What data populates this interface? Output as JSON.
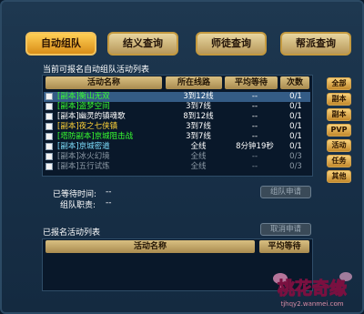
{
  "tabs": [
    {
      "label": "自动组队",
      "active": true
    },
    {
      "label": "结义查询",
      "active": false
    },
    {
      "label": "师徒查询",
      "active": false
    },
    {
      "label": "帮派查询",
      "active": false
    }
  ],
  "available_title": "当前可报名自动组队活动列表",
  "columns": {
    "name": "活动名称",
    "lines": "所在线路",
    "wait": "平均等待",
    "count": "次数"
  },
  "activities": [
    {
      "tag": "[副本]",
      "title": "衡山无双",
      "lines": "3到12线",
      "wait": "--",
      "count": "0/1",
      "color": "g",
      "selected": true
    },
    {
      "tag": "[副本]",
      "title": "盗梦空间",
      "lines": "3到7线",
      "wait": "--",
      "count": "0/1",
      "color": "g",
      "selected": false
    },
    {
      "tag": "[副本]",
      "title": "幽灵的镇魂歌",
      "lines": "8到12线",
      "wait": "--",
      "count": "0/1",
      "color": "w",
      "selected": false
    },
    {
      "tag": "[副本]",
      "title": "夜之七侠镇",
      "lines": "3到7线",
      "wait": "--",
      "count": "0/1",
      "color": "y",
      "selected": false
    },
    {
      "tag": "[塔防副本]",
      "title": "京城阻击战",
      "lines": "3到7线",
      "wait": "--",
      "count": "0/1",
      "color": "g",
      "selected": false
    },
    {
      "tag": "[副本]",
      "title": "京城密道",
      "lines": "全线",
      "wait": "8分钟19秒",
      "count": "0/1",
      "color": "c",
      "selected": false
    },
    {
      "tag": "[副本]",
      "title": "冰火幻境",
      "lines": "全线",
      "wait": "--",
      "count": "0/3",
      "color": "d",
      "selected": false
    },
    {
      "tag": "[副本]",
      "title": "五行试炼",
      "lines": "全线",
      "wait": "--",
      "count": "0/3",
      "color": "d",
      "selected": false
    }
  ],
  "filters": [
    "全部",
    "副本",
    "副本",
    "PVP",
    "活动",
    "任务",
    "其他"
  ],
  "waited_label": "已等待时间:",
  "waited_value": "--",
  "role_label": "组队职责:",
  "role_value": "--",
  "apply_button": "组队申请",
  "registered_title": "已报名活动列表",
  "cancel_button": "取消申请",
  "registered_columns": {
    "name": "活动名称",
    "wait": "平均等待"
  },
  "logo": {
    "line1": "桃花奇缘",
    "site": "tjhqy2.wanmei.com"
  }
}
